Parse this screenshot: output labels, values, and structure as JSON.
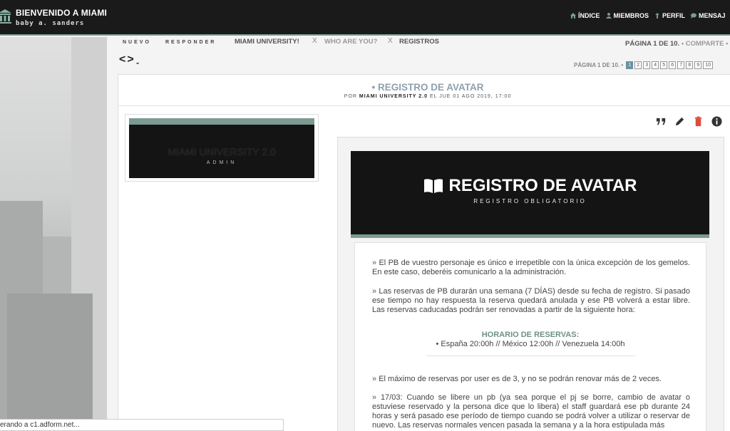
{
  "header": {
    "site_title": "BIENVENIDO A MIAMI",
    "user_name": "baby a. sanders",
    "nav": [
      {
        "label": "ÍNDICE",
        "icon": "home-icon"
      },
      {
        "label": "MIEMBROS",
        "icon": "user-icon"
      },
      {
        "label": "PERFIL",
        "icon": "pin-icon"
      },
      {
        "label": "MENSAJ",
        "icon": "chat-icon"
      }
    ]
  },
  "toolbar": {
    "new_label": "NUEVO",
    "reply_label": "RESPONDER",
    "tabs": [
      {
        "label": "MIAMI UNIVERSITY!",
        "active": true
      },
      {
        "label": "WHO ARE YOU?",
        "active": false
      },
      {
        "label": "REGISTROS",
        "active": true
      }
    ],
    "tab_separator": "X",
    "page_info": "PÁGINA 1 DE 10.",
    "share": "• COMPARTE • ¡I"
  },
  "pagination": {
    "label": "PÁGINA 1 DE 10. •",
    "pages": [
      "1",
      "2",
      "3",
      "4",
      "5",
      "6",
      "7",
      "8",
      "9",
      "10"
    ],
    "current": "1"
  },
  "topic": {
    "title": "• REGISTRO DE AVATAR",
    "by_prefix": "POR",
    "author": "MIAMI UNIVERSITY 2.0",
    "date": "EL JUE 01 AGO 2019, 17:00"
  },
  "author_card": {
    "name": "MIAMI UNIVERSITY 2.0",
    "rank": "ADMIN"
  },
  "post": {
    "banner_title": "REGISTRO DE AVATAR",
    "banner_subtitle": "REGISTRO OBLIGATORIO",
    "arrow": "»",
    "p1": "El PB de vuestro personaje es único e irrepetible con la única excepción de los gemelos. En este caso, deberéis comunicarlo a la administración.",
    "p2": "Las reservas de PB durarán una semana (7 DÍAS) desde su fecha de registro. Si pasado ese tiempo no hay respuesta la reserva quedará anulada y ese PB volverá a estar libre. Las reservas caducadas podrán ser renovadas a partir de la siguiente hora:",
    "schedule_title": "HORARIO DE RESERVAS:",
    "schedule": "• España 20:00h // México 12:00h // Venezuela 14:00h",
    "p3": "El máximo de reservas por user es de 3, y no se podrán renovar más de 2 veces.",
    "p4": "17/03: Cuando se libere un pb (ya sea porque el pj se borre, cambio de avatar o estuviese reservado y la persona dice que lo libera) el staff guardará ese pb durante 24 horas y será pasado ese período de tiempo cuando se podrá volver a utilizar o reservar de nuevo. Las reservas normales vencen pasada la semana y a la hora estipulada más"
  },
  "status_bar": "erando a c1.adform.net...",
  "colors": {
    "accent": "#7a9a92",
    "dark": "#141414",
    "title": "#8ea1ae",
    "delete": "#e04a3a"
  }
}
